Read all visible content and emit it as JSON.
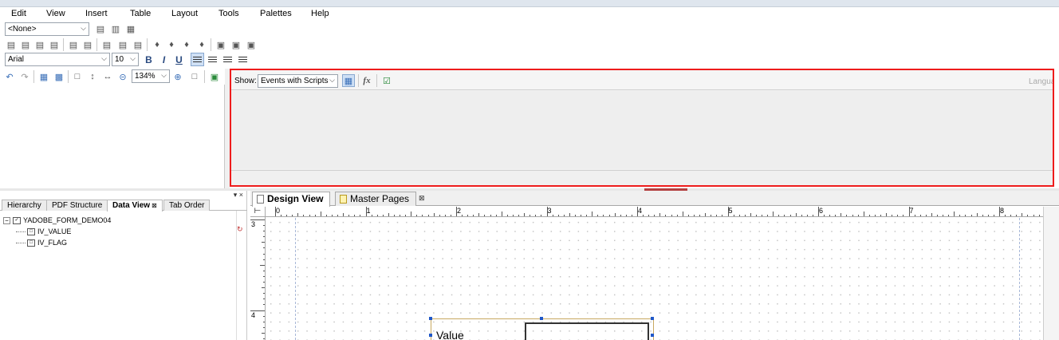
{
  "menu": [
    "Edit",
    "View",
    "Insert",
    "Table",
    "Layout",
    "Tools",
    "Palettes",
    "Help"
  ],
  "toolbar": {
    "style_select": "<None>",
    "font_select": "Arial",
    "font_size_select": "10",
    "bold_label": "B",
    "italic_label": "I",
    "underline_label": "U",
    "zoom_select": "134%"
  },
  "script_editor": {
    "show_label": "Show:",
    "show_select": "Events with Scripts",
    "fx_label": "fx",
    "language_label": "Language"
  },
  "palette": {
    "tabs": [
      "Hierarchy",
      "PDF Structure",
      "Data View",
      "Tab Order"
    ],
    "active_tab": "Data View",
    "tree": {
      "root": "YADOBE_FORM_DEMO04",
      "children": [
        "IV_VALUE",
        "IV_FLAG"
      ]
    }
  },
  "design": {
    "tabs": [
      "Design View",
      "Master Pages"
    ],
    "active_tab": "Design View",
    "ruler_h": [
      "0",
      "1",
      "2",
      "3",
      "4",
      "5",
      "6",
      "7",
      "8"
    ],
    "ruler_v": [
      "3",
      "4"
    ],
    "field_caption": "Value"
  },
  "colors": {
    "highlight_border": "#ee1c1c",
    "selection_handle": "#2058c8"
  }
}
